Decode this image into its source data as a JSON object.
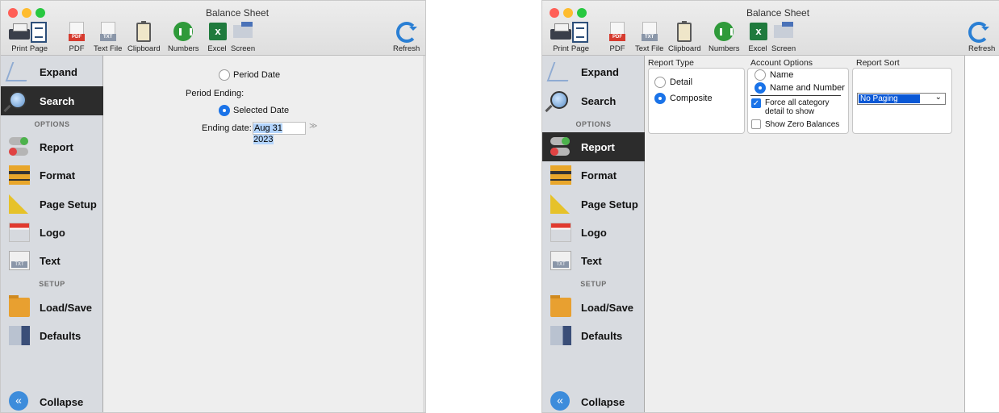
{
  "window": {
    "title": "Balance Sheet"
  },
  "toolbar": {
    "print": "Print",
    "page": "Page",
    "pdf": "PDF",
    "textfile": "Text File",
    "clipboard": "Clipboard",
    "numbers": "Numbers",
    "excel": "Excel",
    "screen": "Screen",
    "refresh": "Refresh",
    "pdf_badge": "PDF",
    "txt_badge": "TXT",
    "excel_badge": "x"
  },
  "sidebar": {
    "expand": "Expand",
    "search": "Search",
    "options_header": "OPTIONS",
    "report": "Report",
    "format": "Format",
    "page_setup": "Page Setup",
    "logo": "Logo",
    "text": "Text",
    "setup_header": "SETUP",
    "load_save": "Load/Save",
    "defaults": "Defaults",
    "collapse": "Collapse"
  },
  "search_panel": {
    "period_date": "Period Date",
    "period_ending": "Period Ending:",
    "selected_date": "Selected Date",
    "ending_date_label": "Ending date:",
    "ending_date_value": "Aug 31 2023"
  },
  "report_panel": {
    "report_type_title": "Report Type",
    "detail": "Detail",
    "composite": "Composite",
    "account_options_title": "Account Options",
    "name": "Name",
    "name_and_number": "Name and Number",
    "force_detail_line1": "Force all category",
    "force_detail_line2": "detail to show",
    "show_zero": "Show Zero Balances",
    "report_sort_title": "Report Sort",
    "sort_value": "No Paging"
  },
  "colors": {
    "accent": "#1a73e8",
    "sidebar_bg": "#d8dbe0",
    "active_item": "#2c2c2c"
  }
}
